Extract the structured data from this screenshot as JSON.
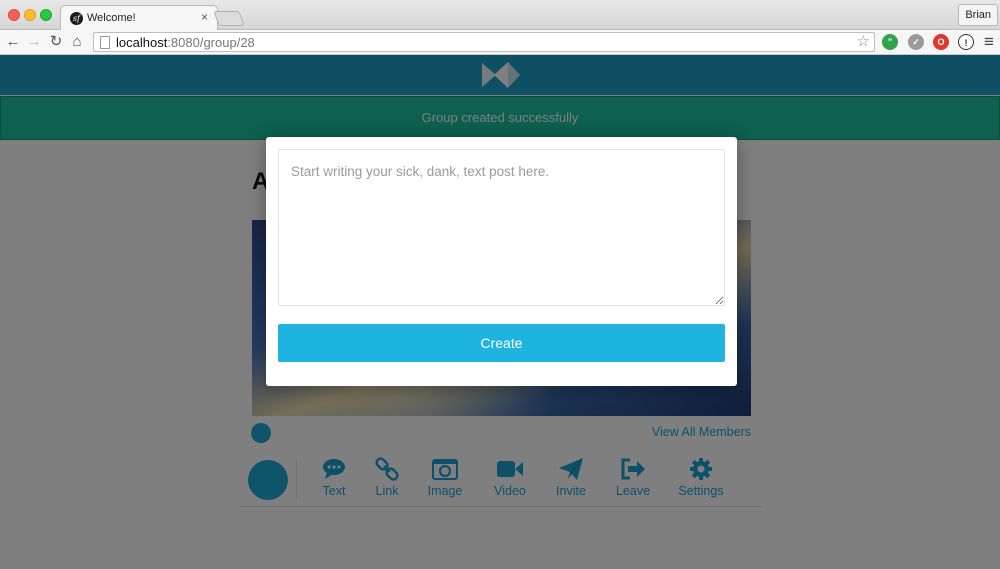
{
  "browser": {
    "tab_title": "Welcome!",
    "tab_close": "×",
    "profile_name": "Brian",
    "url_host": "localhost",
    "url_rest": ":8080/group/28",
    "star": "☆",
    "nav": {
      "back": "←",
      "forward": "→",
      "reload": "↻",
      "home": "⌂"
    },
    "menu": "≡"
  },
  "flash": {
    "message": "Group created successfully"
  },
  "group": {
    "title_partial": "A",
    "view_all_members": "View All Members"
  },
  "actions": [
    {
      "label": "Text",
      "icon": "chat-bubble-icon"
    },
    {
      "label": "Link",
      "icon": "link-icon"
    },
    {
      "label": "Image",
      "icon": "image-icon"
    },
    {
      "label": "Video",
      "icon": "video-camera-icon"
    },
    {
      "label": "Invite",
      "icon": "paper-plane-icon"
    },
    {
      "label": "Leave",
      "icon": "sign-out-icon"
    },
    {
      "label": "Settings",
      "icon": "gear-icon"
    }
  ],
  "modal": {
    "placeholder": "Start writing your sick, dank, text post here.",
    "create_label": "Create"
  },
  "colors": {
    "header": "#1c9fc6",
    "flash": "#18c09a",
    "accent": "#1aa3d2",
    "create_button": "#1fb3df"
  }
}
